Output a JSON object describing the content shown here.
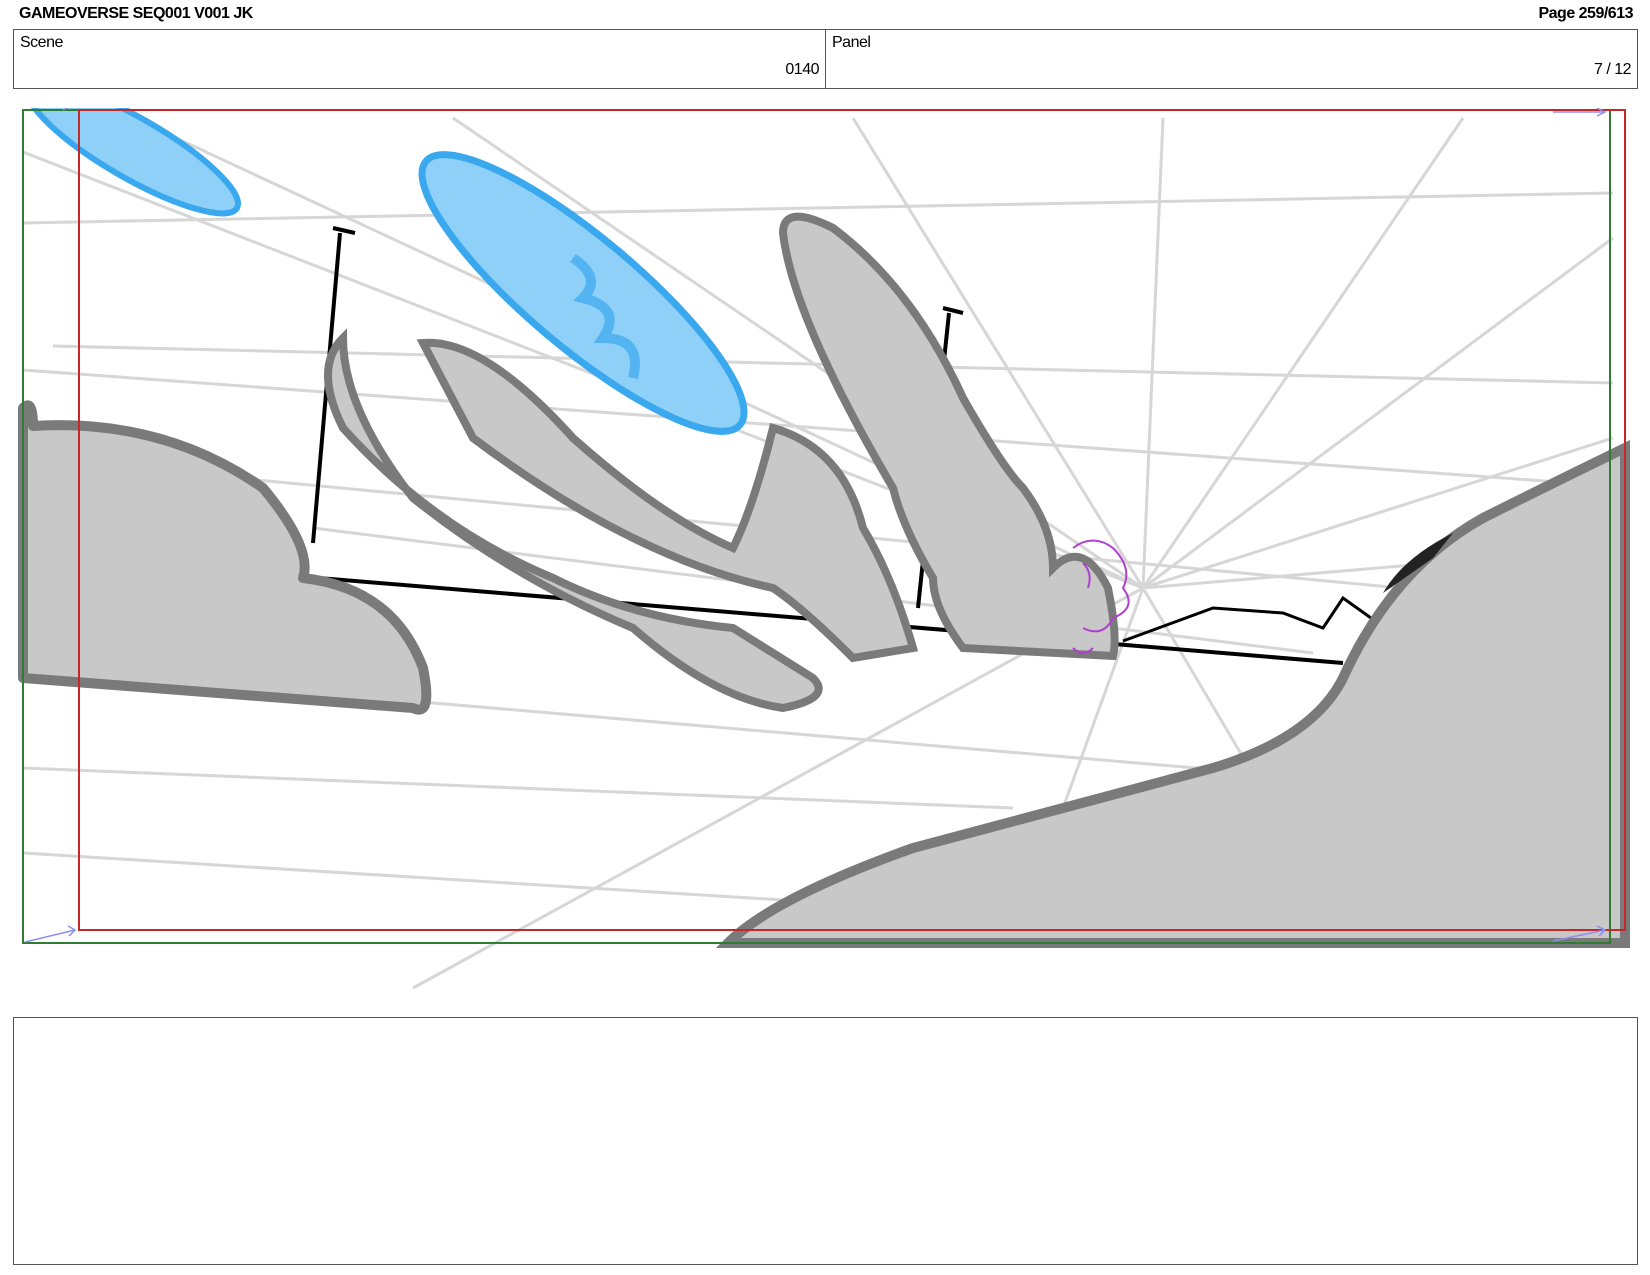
{
  "header": {
    "title": "GAMEOVERSE SEQ001 V001 JK",
    "page": "Page 259/613"
  },
  "info": {
    "scene_label": "Scene",
    "scene_value": "0140",
    "panel_label": "Panel",
    "panel_value": "7 / 12"
  },
  "colors": {
    "safe_frame": "#2e7d32",
    "camera_frame": "#c62828",
    "fill_gray": "#c8c8c8",
    "outline_gray": "#7a7a7a",
    "blue_object": "#4ab3f0",
    "magenta_sketch": "#b040d0"
  }
}
